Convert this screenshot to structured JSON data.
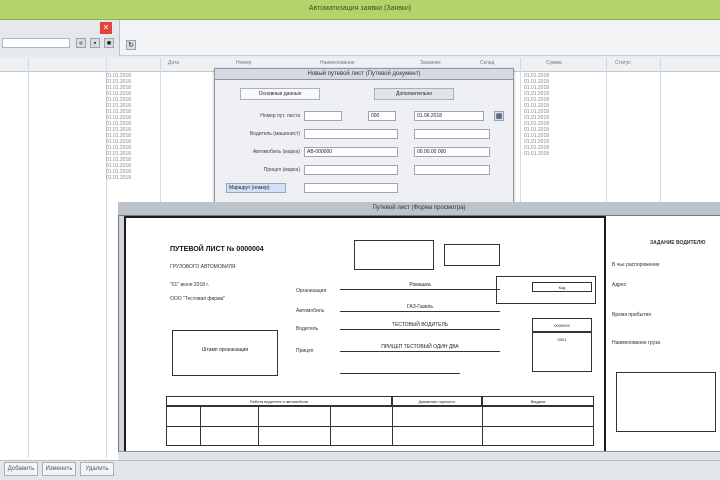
{
  "window": {
    "title": "Автоматизация заявки (Заявки)",
    "close_glyph": "✕"
  },
  "toolbar": {
    "icons": [
      "first-icon",
      "prev-icon",
      "next-icon",
      "last-icon",
      "print-icon",
      "save-icon",
      "refresh-icon"
    ],
    "field1": "",
    "field2": ""
  },
  "grid": {
    "headers": [
      "",
      "",
      "Дата",
      "",
      "Номер",
      "Наименование",
      "Заказчик",
      "Склад",
      "",
      "",
      "Сумма",
      "Статус",
      "",
      ""
    ],
    "dates_left": [
      "01.01.2018",
      "01.01.2018",
      "01.01.2018",
      "01.01.2018",
      "01.01.2018",
      "01.01.2018",
      "01.01.2018",
      "01.01.2018",
      "01.01.2018",
      "01.01.2018",
      "01.01.2018",
      "01.01.2018",
      "01.01.2018",
      "01.01.2018",
      "01.01.2018",
      "01.01.2018",
      "01.01.2018",
      "01.01.2018"
    ],
    "dates_right": [
      "01.01.2018",
      "01.01.2018",
      "01.01.2018",
      "01.01.2018",
      "01.01.2018",
      "01.01.2018",
      "01.01.2018",
      "01.01.2018",
      "01.01.2018",
      "01.01.2018",
      "01.01.2018",
      "01.01.2018",
      "01.01.2018",
      "01.01.2018"
    ]
  },
  "dialog": {
    "title": "Новый путевой лист (Путевой документ)",
    "tabs": [
      "Основные данные",
      "Дополнительно"
    ],
    "fields": [
      {
        "label": "Номер пут. листа",
        "value": "",
        "value2": "000",
        "value3": "01.06.2018"
      },
      {
        "label": "Водитель (машинист)",
        "value": "",
        "value2": "",
        "value3": ""
      },
      {
        "label": "Автомобиль (марка)",
        "value": "АВ-000000",
        "value2": "",
        "value3": "00.00.00 000"
      },
      {
        "label": "Прицеп (марка)",
        "value": "",
        "value2": "",
        "value3": ""
      },
      {
        "label": "Маршрут (номер)",
        "value": "",
        "value2": "",
        "value3": ""
      }
    ]
  },
  "preview": {
    "title": "Путевой лист (Форма просмотра)",
    "doc_title": "ПУТЕВОЙ ЛИСТ № 0000004",
    "doc_subtitle": "ГРУЗОВОГО АВТОМОБИЛЯ",
    "date_line": "\"01\" июня 2018 г.",
    "org_line": "ООО \"Тестовая фирма\"",
    "stamp": "Штамп организации",
    "fields": [
      "Организация",
      "Автомобиль",
      "Водитель",
      "Прицеп"
    ],
    "values": [
      "Ромашка",
      "ГАЗ-Газель",
      "ТЕСТОВЫЙ ВОДИТЕЛЬ",
      "ПРИЦЕП ТЕСТОВЫЙ ОДИН ДВА"
    ],
    "codes": [
      "Код",
      "0000004",
      "0001"
    ],
    "table_head": [
      "Работа водителя и автомобиля",
      "Движение горючего",
      "Выдача"
    ],
    "right_title": "ЗАДАНИЕ ВОДИТЕЛЮ",
    "right_lines": [
      "В чье распоряжение",
      "Адрес",
      "Время прибытия",
      "Наименование груза"
    ]
  },
  "status": {
    "buttons": [
      "Добавить",
      "Изменить",
      "Удалить"
    ]
  }
}
